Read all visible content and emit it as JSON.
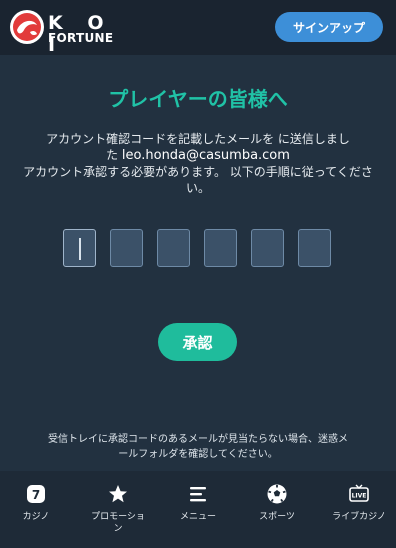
{
  "header": {
    "logo_top": "K O I",
    "logo_bottom": "FORTUNE",
    "signup_label": "サインアップ"
  },
  "main": {
    "title": "プレイヤーの皆様へ",
    "message_line1": "アカウント確認コードを記載したメールを に送信しまし",
    "message_line2_pre": "た",
    "email": "leo.honda@casumba.com",
    "message_line3": "アカウント承認する必要があります。 以下の手順に従ってくださ",
    "message_line4": "い。",
    "code_digits": [
      "",
      "",
      "",
      "",
      "",
      ""
    ],
    "approve_label": "承認",
    "notice_line1": "受信トレイに承認コードのあるメールが見当たらない場合、迷惑メ",
    "notice_line2": "ールフォルダを確認してください。"
  },
  "nav": {
    "items": [
      {
        "label": "カジノ",
        "icon": "casino-icon"
      },
      {
        "label": "プロモーショ\nン",
        "icon": "star-icon"
      },
      {
        "label": "メニュー",
        "icon": "menu-icon"
      },
      {
        "label": "スポーツ",
        "icon": "soccer-ball-icon"
      },
      {
        "label": "ライブカジノ",
        "icon": "live-tv-icon"
      }
    ]
  },
  "colors": {
    "accent": "#20c2a6",
    "primary_button": "#3d8fd8",
    "background": "#223140",
    "header": "#1a2430"
  }
}
